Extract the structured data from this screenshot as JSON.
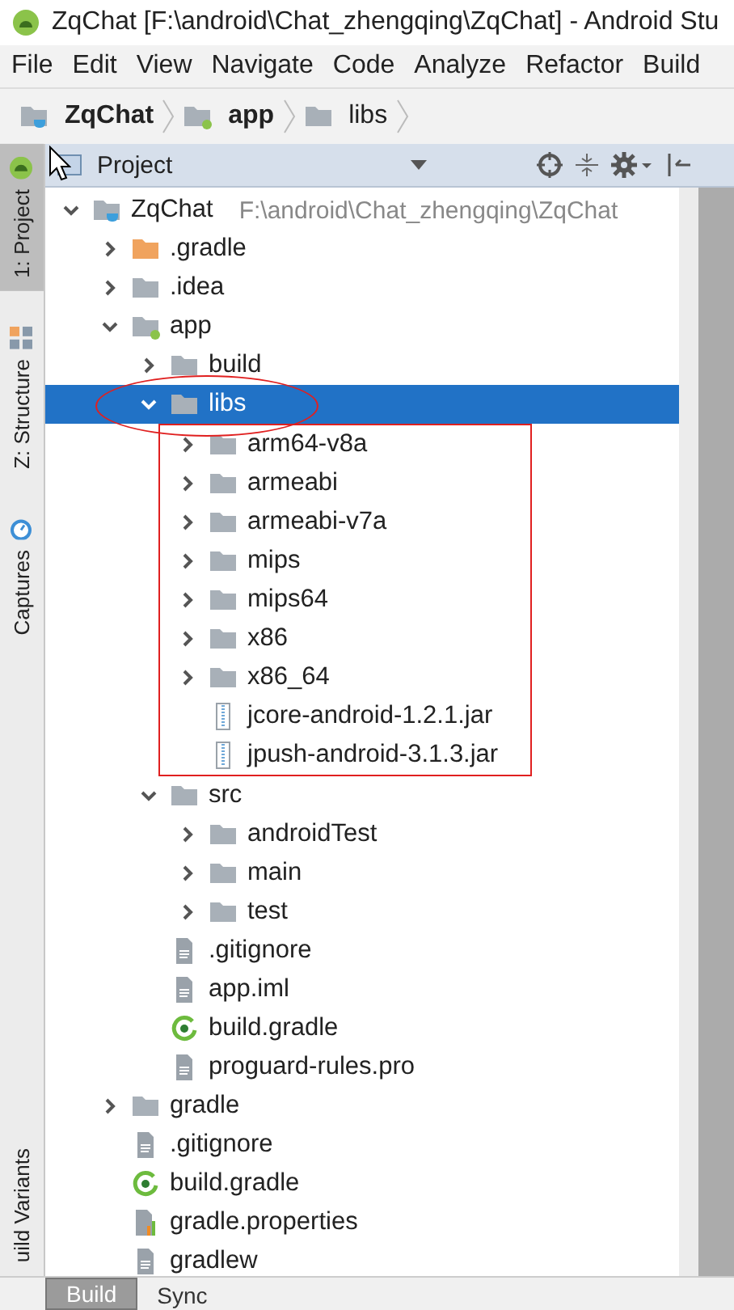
{
  "window": {
    "title": "ZqChat [F:\\android\\Chat_zhengqing\\ZqChat] - Android Stu"
  },
  "menu": [
    "File",
    "Edit",
    "View",
    "Navigate",
    "Code",
    "Analyze",
    "Refactor",
    "Build"
  ],
  "breadcrumb": [
    {
      "label": "ZqChat",
      "kind": "project"
    },
    {
      "label": "app",
      "kind": "module"
    },
    {
      "label": "libs",
      "kind": "folder"
    }
  ],
  "side_tabs": [
    {
      "label": "1: Project",
      "kind": "android",
      "selected": true
    },
    {
      "label": "Z: Structure",
      "kind": "structure",
      "selected": false
    },
    {
      "label": "Captures",
      "kind": "captures",
      "selected": false
    },
    {
      "label": "uild Variants",
      "kind": "none",
      "selected": false
    }
  ],
  "panel": {
    "title": "Project"
  },
  "tree": [
    {
      "name": "ZqChat",
      "path": "F:\\android\\Chat_zhengqing\\ZqChat",
      "kind": "project",
      "expanded": true,
      "selected": false,
      "children": [
        {
          "name": ".gradle",
          "kind": "gradle-folder",
          "expanded": false,
          "selected": false
        },
        {
          "name": ".idea",
          "kind": "folder",
          "expanded": false,
          "selected": false
        },
        {
          "name": "app",
          "kind": "module",
          "expanded": true,
          "selected": false,
          "children": [
            {
              "name": "build",
              "kind": "folder",
              "expanded": false,
              "selected": false
            },
            {
              "name": "libs",
              "kind": "folder",
              "expanded": true,
              "selected": true,
              "annotated": true,
              "children": [
                {
                  "name": "arm64-v8a",
                  "kind": "folder",
                  "expanded": false,
                  "selected": false
                },
                {
                  "name": "armeabi",
                  "kind": "folder",
                  "expanded": false,
                  "selected": false
                },
                {
                  "name": "armeabi-v7a",
                  "kind": "folder",
                  "expanded": false,
                  "selected": false
                },
                {
                  "name": "mips",
                  "kind": "folder",
                  "expanded": false,
                  "selected": false
                },
                {
                  "name": "mips64",
                  "kind": "folder",
                  "expanded": false,
                  "selected": false
                },
                {
                  "name": "x86",
                  "kind": "folder",
                  "expanded": false,
                  "selected": false
                },
                {
                  "name": "x86_64",
                  "kind": "folder",
                  "expanded": false,
                  "selected": false
                },
                {
                  "name": "jcore-android-1.2.1.jar",
                  "kind": "jar",
                  "selected": false
                },
                {
                  "name": "jpush-android-3.1.3.jar",
                  "kind": "jar",
                  "selected": false
                }
              ]
            },
            {
              "name": "src",
              "kind": "folder",
              "expanded": true,
              "selected": false,
              "children": [
                {
                  "name": "androidTest",
                  "kind": "folder",
                  "expanded": false,
                  "selected": false
                },
                {
                  "name": "main",
                  "kind": "folder",
                  "expanded": false,
                  "selected": false
                },
                {
                  "name": "test",
                  "kind": "folder",
                  "expanded": false,
                  "selected": false
                }
              ]
            },
            {
              "name": ".gitignore",
              "kind": "file",
              "selected": false
            },
            {
              "name": "app.iml",
              "kind": "file",
              "selected": false
            },
            {
              "name": "build.gradle",
              "kind": "gradle",
              "selected": false
            },
            {
              "name": "proguard-rules.pro",
              "kind": "file",
              "selected": false
            }
          ]
        },
        {
          "name": "gradle",
          "kind": "folder",
          "expanded": false,
          "selected": false
        },
        {
          "name": ".gitignore",
          "kind": "file",
          "selected": false
        },
        {
          "name": "build.gradle",
          "kind": "gradle",
          "selected": false
        },
        {
          "name": "gradle.properties",
          "kind": "properties",
          "selected": false
        },
        {
          "name": "gradlew",
          "kind": "file",
          "selected": false
        }
      ]
    }
  ],
  "bottom_tabs": [
    {
      "label": "Build",
      "selected": true
    },
    {
      "label": "Sync",
      "selected": false
    }
  ]
}
